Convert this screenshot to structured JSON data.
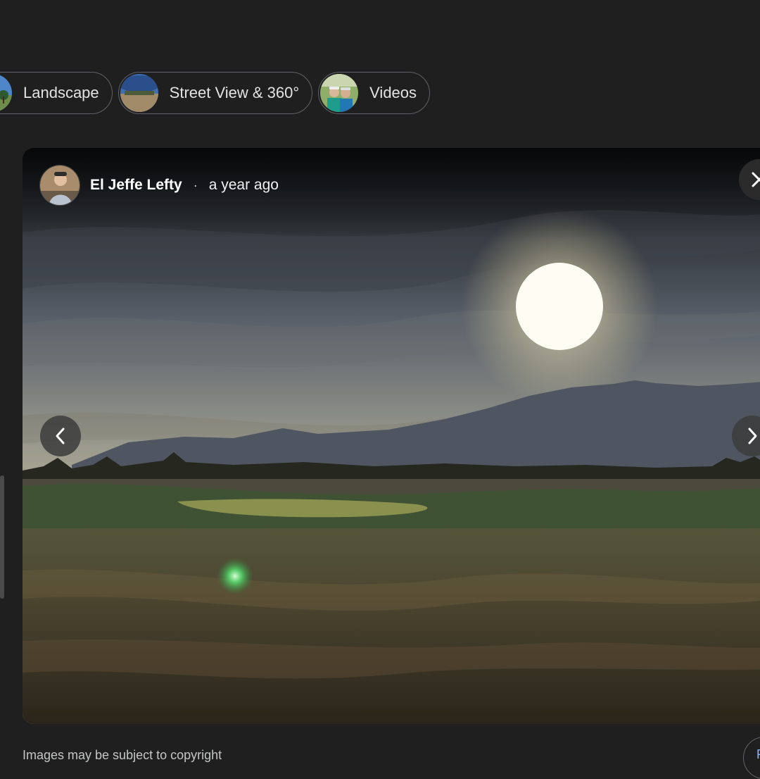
{
  "chips": [
    {
      "label": "Landscape"
    },
    {
      "label": "Street View & 360°"
    },
    {
      "label": "Videos"
    }
  ],
  "viewer": {
    "author_name": "El Jeffe Lefty",
    "separator": "·",
    "posted": "a year ago"
  },
  "footer": {
    "copyright_note": "Images may be subject to copyright",
    "button_glyph": "F"
  },
  "icons": {
    "close": "close-icon",
    "prev": "chevron-left-icon",
    "next": "chevron-right-icon"
  }
}
